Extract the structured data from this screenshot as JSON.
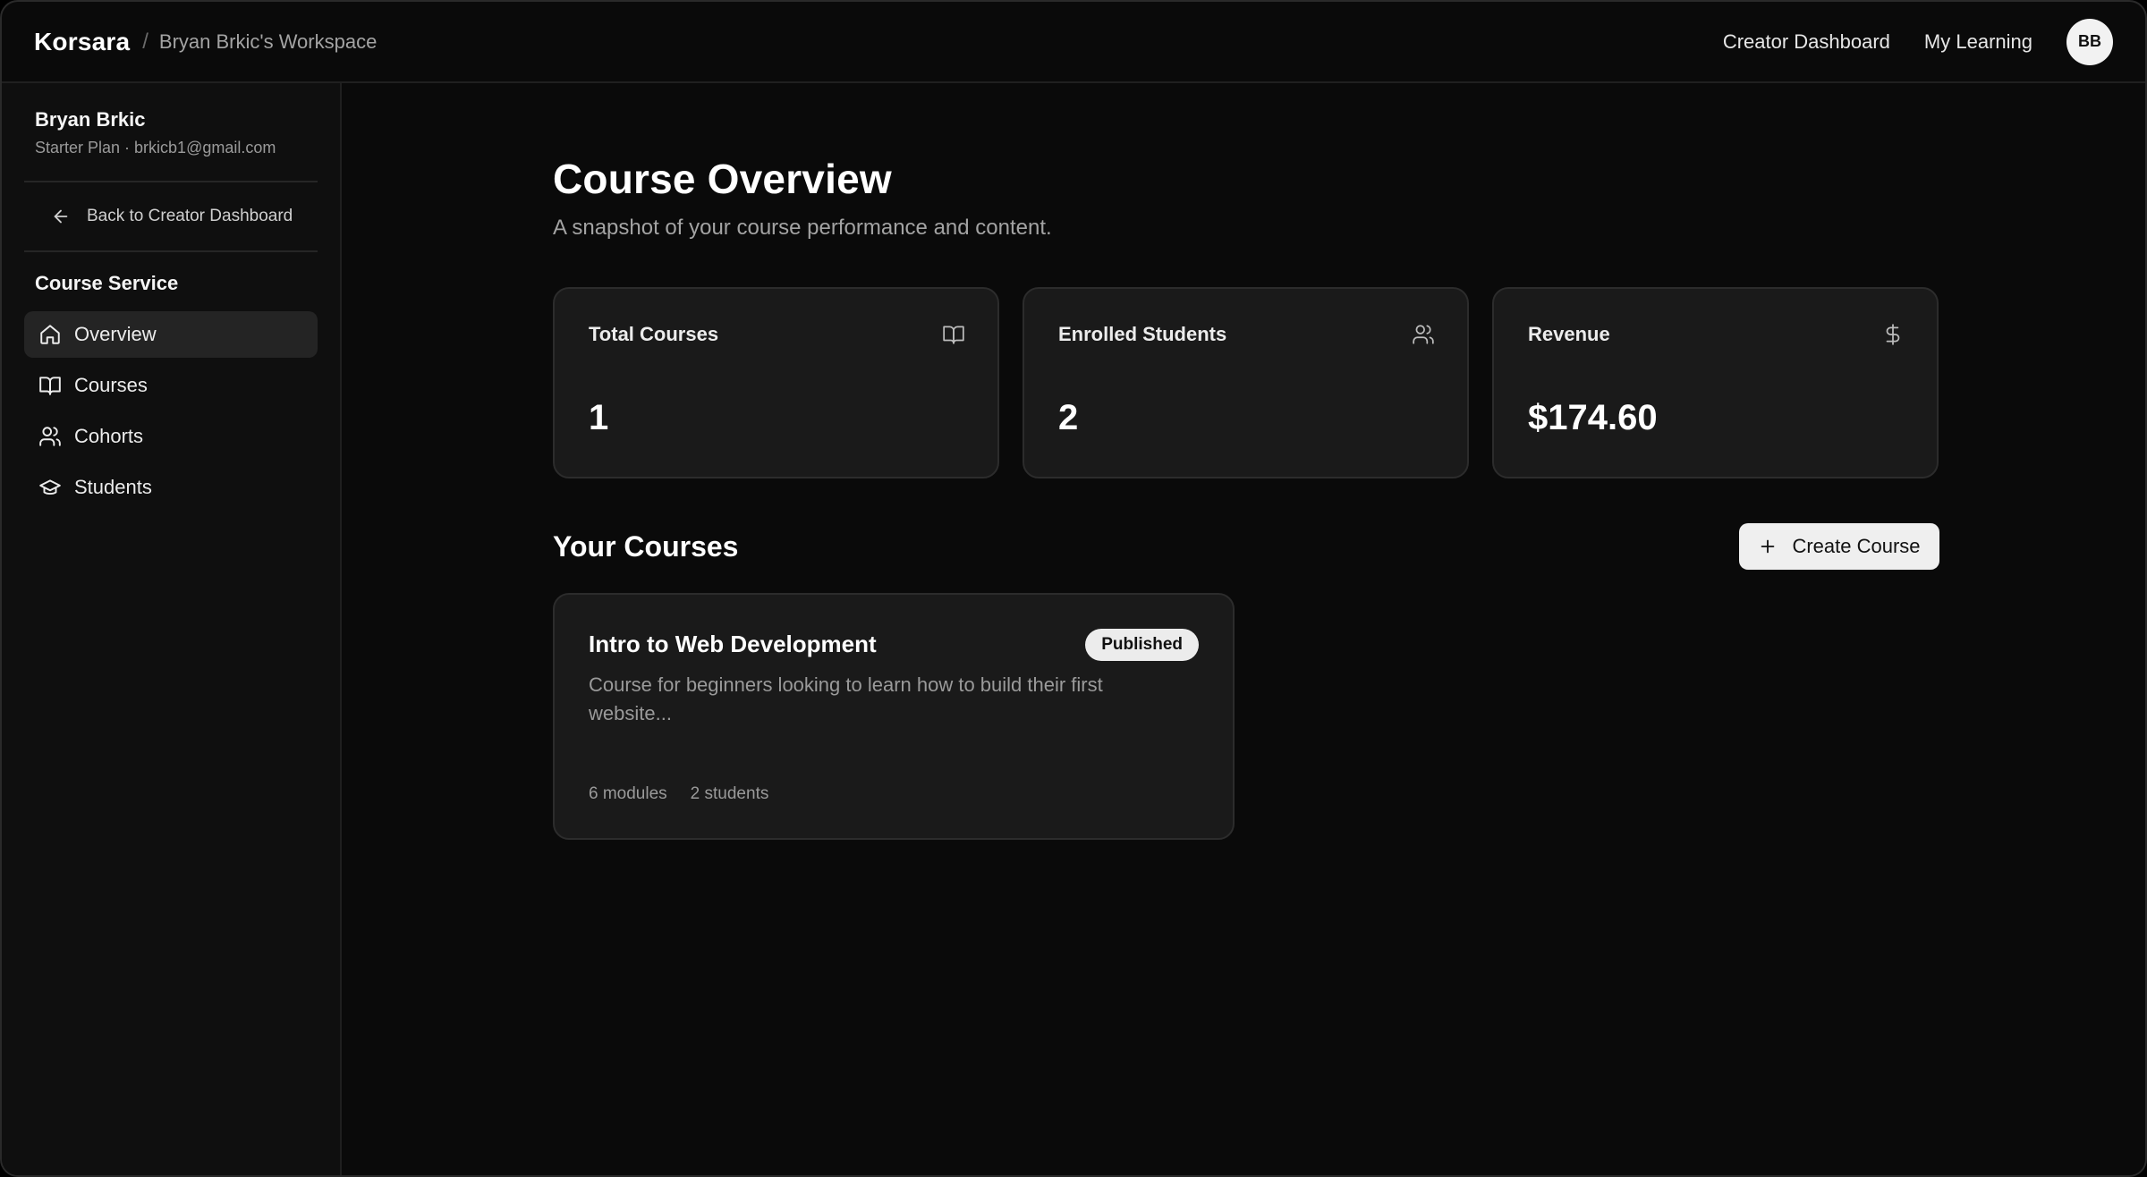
{
  "topbar": {
    "brand": "Korsara",
    "separator": "/",
    "workspace": "Bryan Brkic's Workspace",
    "nav": [
      "Creator Dashboard",
      "My Learning"
    ],
    "avatar_initials": "BB"
  },
  "sidebar": {
    "user_name": "Bryan Brkic",
    "user_meta": "Starter Plan · brkicb1@gmail.com",
    "back_label": "Back to Creator Dashboard",
    "section_title": "Course Service",
    "items": [
      {
        "label": "Overview",
        "icon": "home-icon",
        "active": true
      },
      {
        "label": "Courses",
        "icon": "book-open-icon",
        "active": false
      },
      {
        "label": "Cohorts",
        "icon": "users-icon",
        "active": false
      },
      {
        "label": "Students",
        "icon": "graduation-cap-icon",
        "active": false
      }
    ]
  },
  "main": {
    "title": "Course Overview",
    "subtitle": "A snapshot of your course performance and content.",
    "stats": [
      {
        "label": "Total Courses",
        "value": "1",
        "icon": "book-open-icon"
      },
      {
        "label": "Enrolled Students",
        "value": "2",
        "icon": "users-icon"
      },
      {
        "label": "Revenue",
        "value": "$174.60",
        "icon": "dollar-icon"
      }
    ],
    "courses_title": "Your Courses",
    "create_label": "Create Course",
    "courses": [
      {
        "title": "Intro to Web Development",
        "status": "Published",
        "description": "Course for beginners looking to learn how to build their first website...",
        "modules": "6 modules",
        "students": "2 students"
      }
    ]
  },
  "colors": {
    "background": "#0a0a0a",
    "card": "#1a1a1a",
    "border": "#2c2c2c",
    "text": "#f2f2f2",
    "muted": "#9a9a9a",
    "button": "#efefef"
  }
}
